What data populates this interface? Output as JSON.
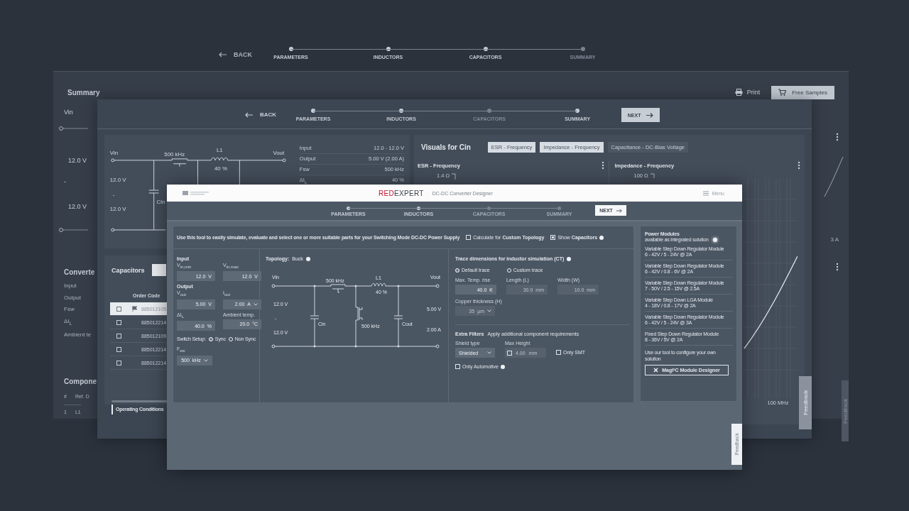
{
  "back_nav": {
    "back": "BACK",
    "steps": [
      {
        "label": "PARAMETERS",
        "active": true
      },
      {
        "label": "INDUCTORS",
        "active": true
      },
      {
        "label": "CAPACITORS",
        "active": true
      },
      {
        "label": "SUMMARY",
        "active": false
      }
    ]
  },
  "summary_window": {
    "title": "Summary",
    "print": "Print",
    "free_samples": "Free Samples",
    "vin_label": "Vin",
    "vin_values": [
      "12.0 V",
      "-",
      "12.0 V"
    ],
    "converter_heading": "Converte",
    "converter_rows": [
      "Input",
      "Output",
      "Fsw",
      "ΔI$_{L}$",
      "Ambient te"
    ],
    "components_heading": "Compone",
    "components_columns": [
      "#",
      "Ref. D"
    ],
    "components_row": [
      "1",
      "L1"
    ],
    "chart_label": "3 A",
    "feedback": "Feedback"
  },
  "middle_window": {
    "back": "BACK",
    "steps": [
      {
        "label": "PARAMETERS",
        "active": true
      },
      {
        "label": "INDUCTORS",
        "active": true
      },
      {
        "label": "CAPACITORS",
        "active": false
      },
      {
        "label": "SUMMARY",
        "active": true
      }
    ],
    "next": "NEXT",
    "schematic": {
      "vin": "Vin",
      "switch_freq": "500 kHz",
      "inductor": "L1",
      "ripple": "40 %",
      "vout": "Vout",
      "input_values": [
        "12.0 V",
        "-",
        "12.0 V"
      ],
      "cin": "Cin"
    },
    "specs": [
      {
        "label": "Input",
        "value": "12.0 - 12.0 V"
      },
      {
        "label": "Output",
        "value": "5.00 V (2.00 A)"
      },
      {
        "label": "Fsw",
        "value": "500 kHz"
      },
      {
        "label": "ΔI$_{L}$",
        "value": "40 %"
      }
    ],
    "visuals": {
      "title": "Visuals for Cin",
      "tabs": [
        {
          "label": "ESR - Frequency",
          "selected": true
        },
        {
          "label": "Impedance - Frequency",
          "selected": true
        },
        {
          "label": "Capacitance - DC-Bias Voltage",
          "selected": false
        }
      ],
      "charts": [
        {
          "title": "ESR - Frequency",
          "y_top": "1.4 Ω"
        },
        {
          "title": "Impedance - Frequency",
          "y_top": "100 Ω",
          "x_label": "100 MHz"
        }
      ]
    },
    "capacitors": {
      "title": "Capacitors",
      "column": "Order Code",
      "rows": [
        {
          "code": "885012105",
          "selected": true,
          "flagged": true
        },
        {
          "code": "885012214",
          "selected": false,
          "flagged": false
        },
        {
          "code": "885012109",
          "selected": false,
          "flagged": false
        },
        {
          "code": "885012214",
          "selected": false,
          "flagged": false
        },
        {
          "code": "885012214",
          "selected": false,
          "flagged": false
        }
      ]
    },
    "operating_conditions": "Operating Conditions",
    "feedback": "Feedback"
  },
  "front_window": {
    "brand_red": "RED",
    "brand_rest": "EXPERT",
    "app_title": "DC-DC Converter Designer",
    "menu": "Menu",
    "steps": [
      {
        "label": "PARAMETERS",
        "active": true
      },
      {
        "label": "INDUCTORS",
        "active": true
      },
      {
        "label": "CAPACITORS",
        "active": false
      },
      {
        "label": "SUMMARY",
        "active": false
      }
    ],
    "next": "NEXT",
    "intro": "Use this tool to easily simulate, evaluate and select one or more suitable parts for your Switching Mode DC-DC Power Supply",
    "options": [
      {
        "label": "Calculate for **Custom Topology**",
        "checked": false,
        "info": false
      },
      {
        "label": "Show **Capacitors**",
        "checked": true,
        "info": true
      }
    ],
    "parameters": [
      {
        "heading": "Input",
        "fields": [
          {
            "label": "V$_{in,min}$",
            "value": "12.0",
            "unit": "V",
            "dropdown": false
          },
          {
            "label": "V$_{in,max}$",
            "value": "12.0",
            "unit": "V",
            "dropdown": false
          }
        ]
      },
      {
        "heading": "Output",
        "fields": [
          {
            "label": "V$_{out}$",
            "value": "5.00",
            "unit": "V",
            "dropdown": false
          },
          {
            "label": "I$_{out}$",
            "value": "2.00",
            "unit": "A",
            "dropdown": true
          }
        ]
      },
      {
        "fields": [
          {
            "label": "ΔI$_{L}$",
            "value": "40.0",
            "unit": "%",
            "dropdown": false
          },
          {
            "label": "Ambient temp.",
            "value": "20.0",
            "unit": "°C",
            "dropdown": false
          }
        ]
      }
    ],
    "switch_setup": {
      "label": "Switch Setup:",
      "options": [
        {
          "label": "Sync",
          "selected": true
        },
        {
          "label": "Non Sync",
          "selected": false
        }
      ]
    },
    "fsw": {
      "label": "F$_{sw}$",
      "value": "500",
      "unit": "kHz"
    },
    "topology": {
      "label": "Topology:",
      "value": "Buck"
    },
    "schematic": {
      "vin": "Vin",
      "high_side": "500 kHz",
      "inductor": "L1",
      "ripple": "40 %",
      "vout": "Vout",
      "input_values": [
        "12.0 V",
        "-",
        "12.0 V"
      ],
      "cin": "Cin",
      "low_side": "500 kHz",
      "cout": "Cout",
      "output_values": [
        "5.00 V",
        "2.00 A"
      ]
    },
    "trace": {
      "title": "Trace dimensions for inductor simulation (CT)",
      "modes": [
        {
          "label": "Default trace",
          "selected": true
        },
        {
          "label": "Custom trace",
          "selected": false
        }
      ],
      "fields": [
        {
          "label": "Max. Temp. rise",
          "value": "40.0",
          "unit": "K",
          "disabled": false
        },
        {
          "label": "Length (L)",
          "value": "30.0",
          "unit": "mm",
          "disabled": true
        },
        {
          "label": "Width (W)",
          "value": "10.0",
          "unit": "mm",
          "disabled": true
        }
      ],
      "copper": {
        "label": "Copper thickness (H)",
        "value": "35",
        "unit": "µm",
        "disabled": true
      }
    },
    "extra_filters": {
      "title": "Extra Filters",
      "note": "Apply additional component requirements",
      "shield_label": "Shield type",
      "shield_value": "Shielded",
      "height_label": "Max Height",
      "height_checked": false,
      "height_value": "4.00",
      "height_unit": "mm",
      "only_smt": {
        "label": "Only SMT",
        "checked": false
      },
      "only_automotive": {
        "label": "Only Automotive",
        "checked": false
      }
    },
    "power_modules": {
      "title": "Power Modules",
      "subtitle": "available as integrated solution",
      "items": [
        {
          "name": "Variable Step Down Regulator Module",
          "spec": "6 - 42V / 5 - 24V @ 2A"
        },
        {
          "name": "Variable Step Down Regulator Module",
          "spec": "6 - 42V / 0.8 - 6V @ 2A"
        },
        {
          "name": "Variable Step Down Regulator Module",
          "spec": "7 - 50V / 2.5 - 15V @ 2.5A"
        },
        {
          "name": "Variable Step Down LGA Module",
          "spec": "4 - 18V / 0.8 - 17V @ 2A"
        },
        {
          "name": "Variable Step Down Regulator Module",
          "spec": "6 - 42V / 5 - 24V @ 3A"
        },
        {
          "name": "Fixed Step Down Regulator Module",
          "spec": "8 - 36V / 5V @ 2A"
        }
      ],
      "hint": "Use our tool to configure your own solution",
      "button": "MagI³C Module Designer"
    },
    "feedback": "Feedback"
  }
}
